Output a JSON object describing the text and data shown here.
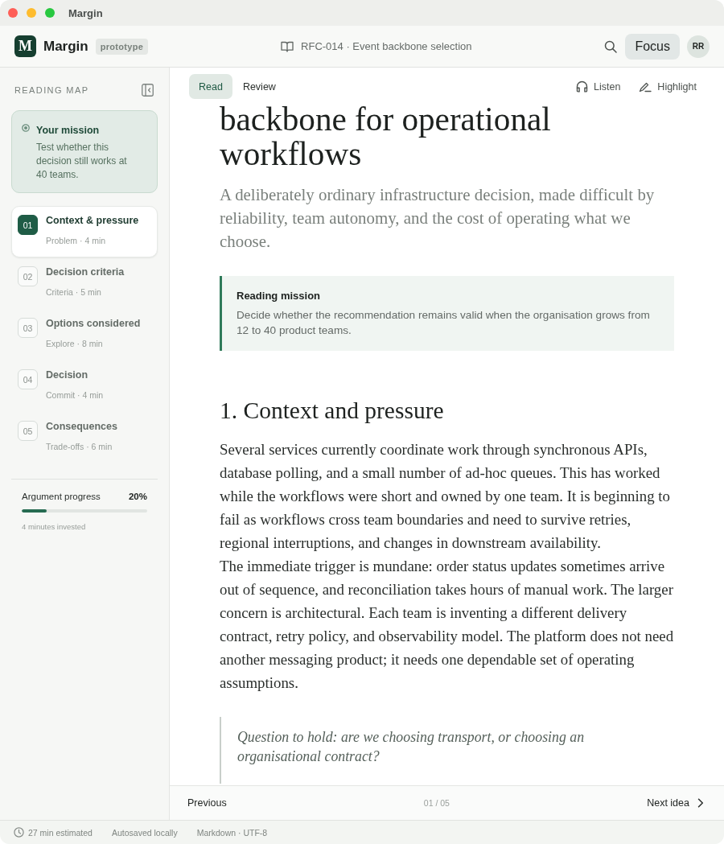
{
  "window": {
    "title": "Margin"
  },
  "header": {
    "logo": "M",
    "app_name": "Margin",
    "badge": "prototype",
    "document": "RFC-014 · Event backbone selection",
    "focus_button": "Focus",
    "avatar": "RR"
  },
  "sidebar": {
    "heading": "READING MAP",
    "mission": {
      "title": "Your mission",
      "text": "Test whether this decision still works at 40 teams."
    },
    "steps": [
      {
        "number": "01",
        "title": "Context & pressure",
        "meta": "Problem · 4 min",
        "selected": true
      },
      {
        "number": "02",
        "title": "Decision criteria",
        "meta": "Criteria · 5 min",
        "selected": false
      },
      {
        "number": "03",
        "title": "Options considered",
        "meta": "Explore · 8 min",
        "selected": false
      },
      {
        "number": "04",
        "title": "Decision",
        "meta": "Commit · 4 min",
        "selected": false
      },
      {
        "number": "05",
        "title": "Consequences",
        "meta": "Trade-offs · 6 min",
        "selected": false
      }
    ],
    "progress": {
      "label": "Argument progress",
      "value": "20%",
      "level": 0.2,
      "note": "4 minutes invested"
    }
  },
  "toolbar": {
    "tabs": [
      {
        "label": "Read",
        "selected": true
      },
      {
        "label": "Review",
        "selected": false
      }
    ],
    "actions": [
      {
        "kind": "listen",
        "label": "Listen"
      },
      {
        "kind": "highlight",
        "label": "Highlight"
      }
    ]
  },
  "article": {
    "title": "backbone for operational workflows",
    "subtitle": "A deliberately ordinary infrastructure decision, made difficult by reliability, team autonomy, and the cost of operating what we choose.",
    "callout": {
      "title": "Reading mission",
      "text": "Decide whether the recommendation remains valid when the organisation grows from 12 to 40 product teams."
    },
    "section_heading": "1. Context and pressure",
    "paragraphs": [
      "Several services currently coordinate work through synchronous APIs, database polling, and a small number of ad-hoc queues. This has worked while the workflows were short and owned by one team. It is beginning to fail as workflows cross team boundaries and need to survive retries, regional interruptions, and changes in downstream availability.",
      "The immediate trigger is mundane: order status updates sometimes arrive out of sequence, and reconciliation takes hours of manual work. The larger concern is architectural. Each team is inventing a different delivery contract, retry policy, and observability model. The platform does not need another messaging product; it needs one dependable set of operating assumptions."
    ],
    "quote": "Question to hold: are we choosing transport, or choosing an organisational contract?"
  },
  "pager": {
    "previous": "Previous",
    "position": "01 / 05",
    "next": "Next idea"
  },
  "status_bar": [
    {
      "kind": "time",
      "text": "27 min estimated"
    },
    {
      "kind": "plain",
      "text": "Autosaved locally"
    },
    {
      "kind": "plain",
      "text": "Markdown · UTF-8"
    }
  ]
}
